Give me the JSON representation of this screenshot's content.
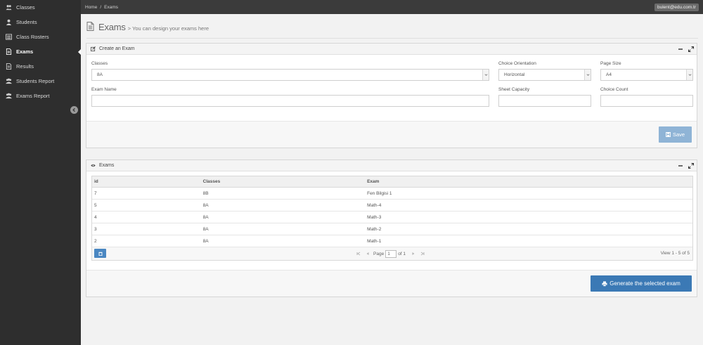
{
  "sidebar": {
    "items": [
      {
        "label": "Classes",
        "icon": "users-icon"
      },
      {
        "label": "Students",
        "icon": "user-icon"
      },
      {
        "label": "Class Rosters",
        "icon": "list-icon"
      },
      {
        "label": "Exams",
        "icon": "document-icon",
        "active": true
      },
      {
        "label": "Results",
        "icon": "document-icon"
      },
      {
        "label": "Students Report",
        "icon": "users-report-icon"
      },
      {
        "label": "Exams Report",
        "icon": "users-report-icon"
      }
    ]
  },
  "topbar": {
    "breadcrumb": [
      "Home",
      "Exams"
    ],
    "separator": "/",
    "user_email": "bulent@edu.com.tr"
  },
  "page": {
    "title": "Exams",
    "subtitle": "> You can design your exams here"
  },
  "create_box": {
    "title": "Create an Exam",
    "classes_label": "Classes",
    "classes_value": "8A",
    "orientation_label": "Choice Orientation",
    "orientation_value": "Horizontal",
    "page_size_label": "Page Size",
    "page_size_value": "A4",
    "exam_name_label": "Exam Name",
    "sheet_capacity_label": "Sheet Capacity",
    "choice_count_label": "Choice Count",
    "save_label": "Save"
  },
  "exams_box": {
    "title": "Exams",
    "columns": [
      "id",
      "Classes",
      "Exam"
    ],
    "rows": [
      {
        "id": "7",
        "classes": "8B",
        "exam": "Fen Bilgisi 1"
      },
      {
        "id": "5",
        "classes": "8A",
        "exam": "Math-4"
      },
      {
        "id": "4",
        "classes": "8A",
        "exam": "Math-3"
      },
      {
        "id": "3",
        "classes": "8A",
        "exam": "Math-2"
      },
      {
        "id": "2",
        "classes": "8A",
        "exam": "Math-1"
      }
    ],
    "pager": {
      "page_label": "Page",
      "page_value": "1",
      "of_label": "of 1",
      "view_info": "View 1 - 5 of 5"
    },
    "generate_label": "Generate the selected exam"
  },
  "colors": {
    "sidebar_bg": "#2e2e2e",
    "topbar_bg": "#3b3b3b",
    "primary": "#3b79b5",
    "save_btn": "#8fb4d6"
  }
}
